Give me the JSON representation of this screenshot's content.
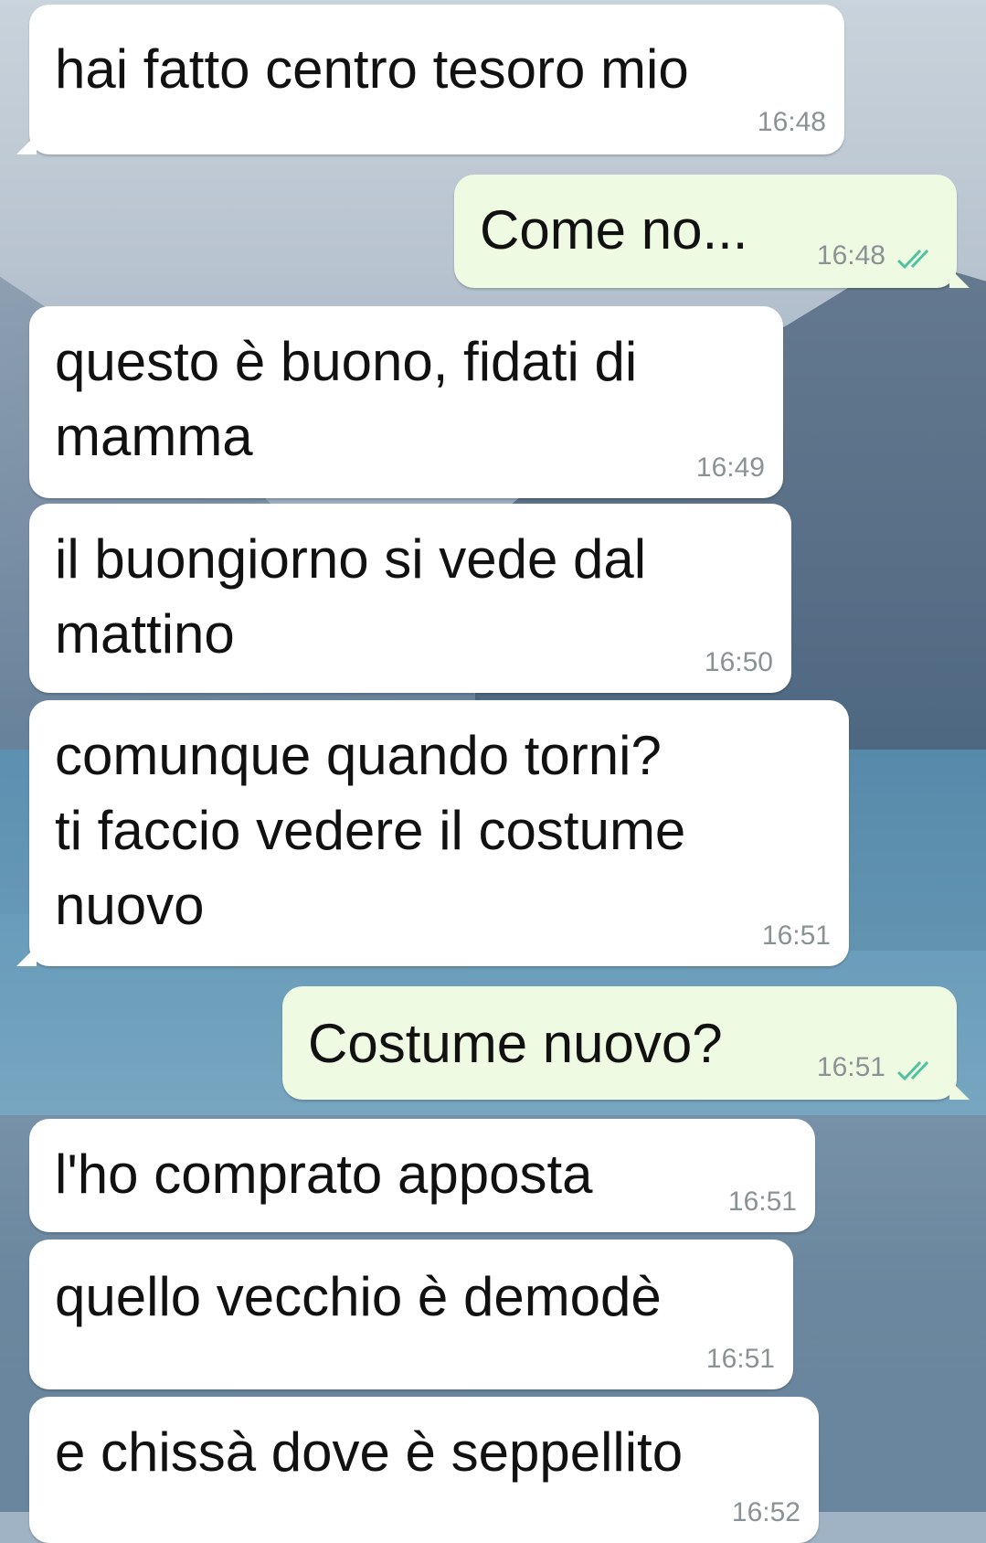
{
  "messages": [
    {
      "text": "hai fatto centro tesoro mio",
      "time": "16:48"
    },
    {
      "text": "Come no...",
      "time": "16:48"
    },
    {
      "text": "questo è buono, fidati di\nmamma",
      "time": "16:49"
    },
    {
      "text": "il buongiorno si vede dal\nmattino",
      "time": "16:50"
    },
    {
      "text": "comunque quando torni?\nti faccio vedere il costume\nnuovo",
      "time": "16:51"
    },
    {
      "text": "Costume nuovo?",
      "time": "16:51"
    },
    {
      "text": "l'ho comprato apposta",
      "time": "16:51"
    },
    {
      "text": "quello vecchio è demodè",
      "time": "16:51"
    },
    {
      "text": "e chissà dove è seppellito",
      "time": "16:52"
    }
  ],
  "colors": {
    "incoming_bubble": "#ffffff",
    "outgoing_bubble": "#eefbe2",
    "timestamp": "#8b9296",
    "read_ticks": "#4fc3a1"
  },
  "icons": {
    "read_receipt": "double-check-icon"
  }
}
